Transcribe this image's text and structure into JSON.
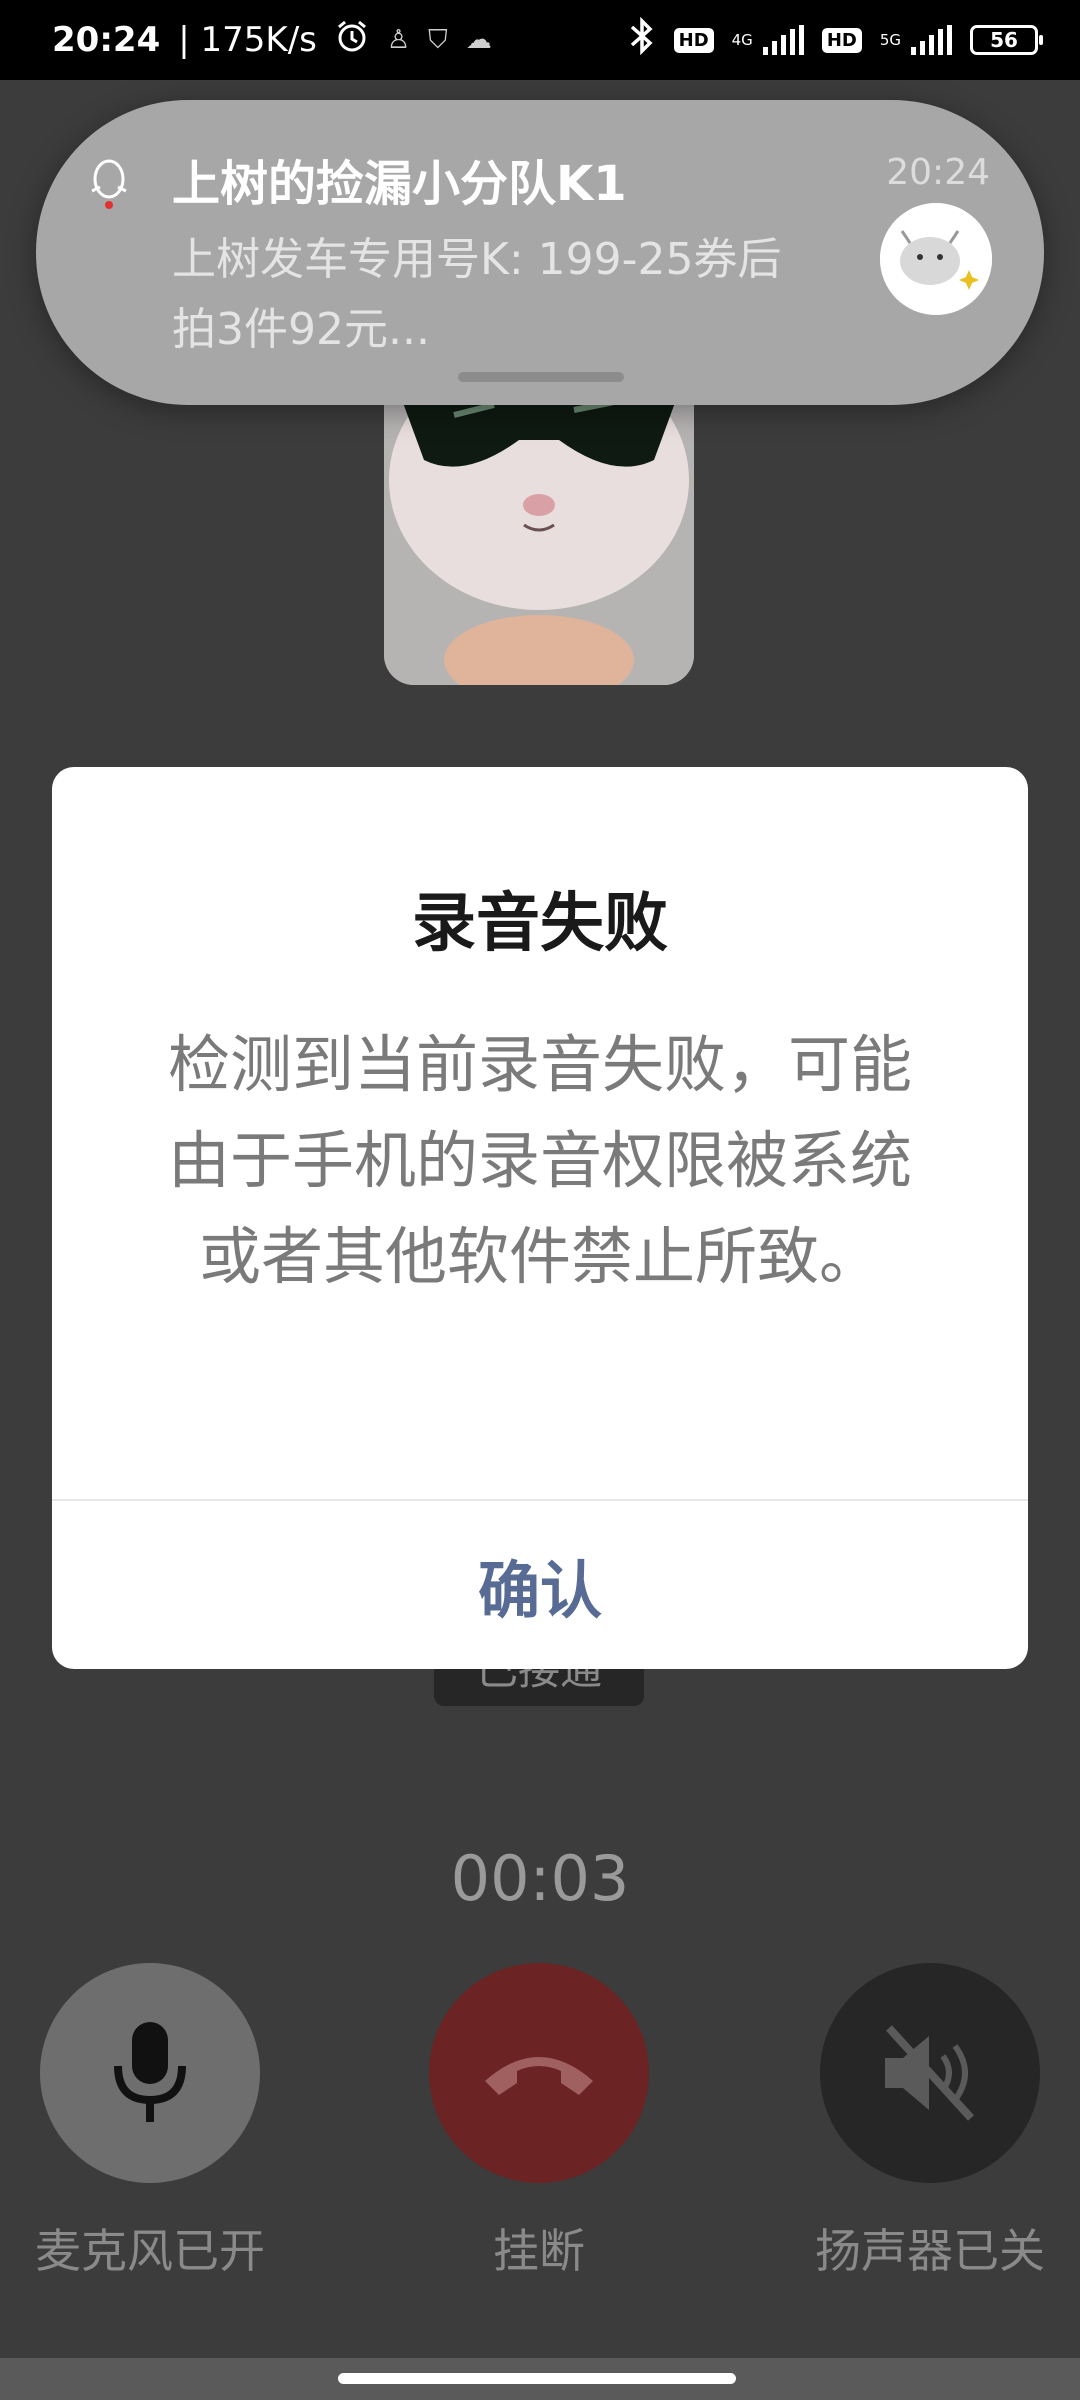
{
  "status_bar": {
    "time": "20:24",
    "net_speed": "| 175K/s",
    "network_1": "4G",
    "network_2": "5G",
    "hd_label": "HD",
    "battery": "56"
  },
  "notification": {
    "title": "上树的捡漏小分队K1",
    "time": "20:24",
    "message": "上树发车专用号K: 199-25券后  拍3件92元..."
  },
  "dialog": {
    "title": "录音失败",
    "message": "检测到当前录音失败，可能由于手机的录音权限被系统或者其他软件禁止所致。",
    "confirm_label": "确认"
  },
  "call": {
    "status": "已接通",
    "timer": "00:03",
    "mic_label": "麦克风已开",
    "hangup_label": "挂断",
    "speaker_label": "扬声器已关"
  },
  "colors": {
    "dialog_confirm": "#576b95",
    "hangup_button": "#6b2323",
    "overlay_bg": "#3c3c3c"
  },
  "icons": [
    "alarm-icon",
    "qq-icon",
    "bluetooth-icon",
    "signal-icon",
    "battery-icon",
    "microphone-icon",
    "phone-hangup-icon",
    "speaker-muted-icon"
  ]
}
